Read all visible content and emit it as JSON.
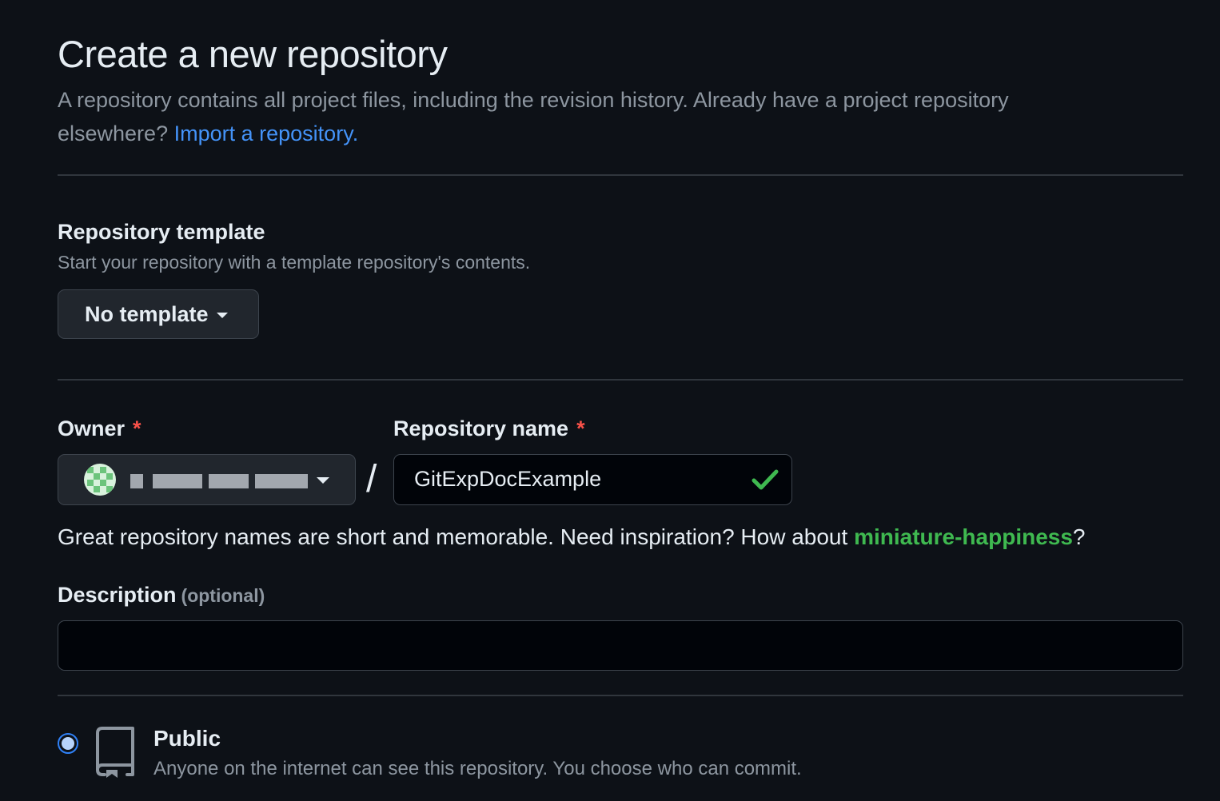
{
  "header": {
    "title": "Create a new repository",
    "intro": "A repository contains all project files, including the revision history. Already have a project repository elsewhere?",
    "import_link": "Import a repository."
  },
  "template": {
    "title": "Repository template",
    "note": "Start your repository with a template repository's contents.",
    "selected": "No template"
  },
  "owner": {
    "label": "Owner",
    "required_mark": "*",
    "avatar_icon": "identicon-avatar",
    "name_redacted": true
  },
  "repository": {
    "separator": "/",
    "label": "Repository name",
    "required_mark": "*",
    "value": "GitExpDocExample",
    "valid_icon": "check-icon",
    "hint_prefix": "Great repository names are short and memorable. Need inspiration? How about",
    "suggestion": "miniature-happiness",
    "hint_suffix": "?"
  },
  "description": {
    "label": "Description",
    "optional_note": "(optional)",
    "value": ""
  },
  "visibility": {
    "public": {
      "title": "Public",
      "note": "Anyone on the internet can see this repository. You choose who can commit.",
      "selected": true,
      "icon": "repo-icon"
    }
  },
  "colors": {
    "background": "#0d1117",
    "link": "#4493f8",
    "success": "#3fb950",
    "required": "#f85149"
  }
}
